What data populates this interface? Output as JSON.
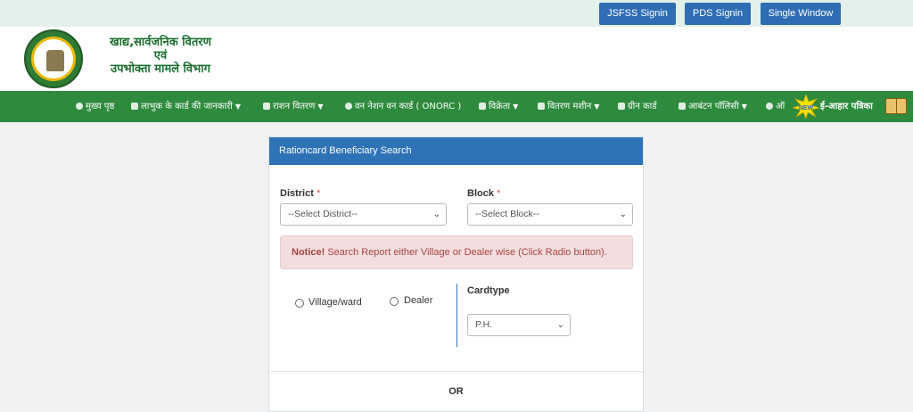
{
  "top_buttons": {
    "jsfss": "JSFSS Signin",
    "pds": "PDS Signin",
    "single_window": "Single Window"
  },
  "header": {
    "title_line1": "खाद्य,सार्वजनिक वितरण",
    "title_line2": "एवं",
    "title_line3": "उपभोक्ता मामले विभाग"
  },
  "nav": {
    "items": [
      {
        "label": "मुख्य पृष्ठ",
        "icon": "home-icon",
        "dropdown": false
      },
      {
        "label": "लाभुक के कार्ड की जानकारी",
        "icon": "card-icon",
        "dropdown": true
      },
      {
        "label": "राशन वितरण",
        "icon": "user-icon",
        "dropdown": true
      },
      {
        "label": "वन नेशन वन कार्ड ( ONORC )",
        "icon": "globe-icon",
        "dropdown": false
      },
      {
        "label": "विक्रेता",
        "icon": "person-icon",
        "dropdown": true
      },
      {
        "label": "वितरण मशीन",
        "icon": "machine-icon",
        "dropdown": true
      },
      {
        "label": "ग्रीन कार्ड",
        "icon": "shuffle-icon",
        "dropdown": false
      },
      {
        "label": "आबंटन पॉलिसी",
        "icon": "leaf-icon",
        "dropdown": true
      },
      {
        "label": "ऑ",
        "icon": "globe-icon",
        "dropdown": false
      },
      {
        "label": "ई-आहार पत्रिका",
        "icon": "book-icon",
        "dropdown": false
      }
    ],
    "new_badge": "NEW"
  },
  "panel": {
    "title": "Rationcard Beneficiary Search",
    "district_label": "District",
    "block_label": "Block",
    "required_mark": "*",
    "district_value": "--Select District--",
    "block_value": "--Select Block--",
    "notice_strong": "Notice!",
    "notice_text": " Search Report either Village or Dealer wise (Click Radio button).",
    "radio_village": "Village/ward",
    "radio_dealer": "Dealer",
    "cardtype_label": "Cardtype",
    "cardtype_value": "P.H.",
    "or_text": "OR"
  },
  "colors": {
    "nav_green": "#2e8b3d",
    "button_blue": "#2e6db4",
    "panel_header": "#2f73b7",
    "notice_bg": "#f2dede"
  }
}
